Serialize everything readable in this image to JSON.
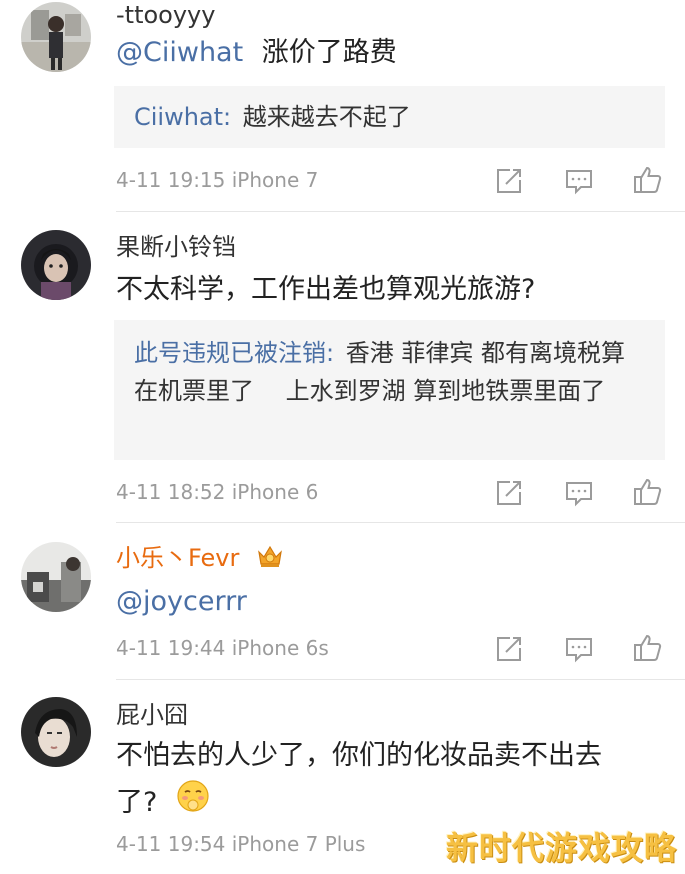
{
  "comments": [
    {
      "username": "-ttooyyy",
      "mention": "@Ciiwhat",
      "text": "涨价了路费",
      "reply_name": "Ciiwhat:",
      "reply_text": "越来越去不起了",
      "meta": "4-11 19:15 iPhone 7"
    },
    {
      "username": "果断小铃铛",
      "text": "不太科学，工作出差也算观光旅游?",
      "reply_name": "此号违规已被注销:",
      "reply_text": "香港 菲律宾 都有离境税算在机票里了　 上水到罗湖 算到地铁票里面了",
      "meta": "4-11 18:52 iPhone 6"
    },
    {
      "username": "小乐丶Fevr",
      "mention": "@joycerrr",
      "meta": "4-11 19:44 iPhone 6s"
    },
    {
      "username": "屁小囧",
      "text": "不怕去的人少了，你们的化妆品卖不出去了?",
      "meta": "4-11 19:54 iPhone 7 Plus"
    }
  ],
  "watermark": "新时代游戏攻略",
  "colors": {
    "mention": "#4a6fa5",
    "username_vip": "#e86b10",
    "meta": "#9b9b9b",
    "reply_bg": "#f5f5f5"
  },
  "icons": [
    "share-icon",
    "comment-icon",
    "like-icon"
  ]
}
